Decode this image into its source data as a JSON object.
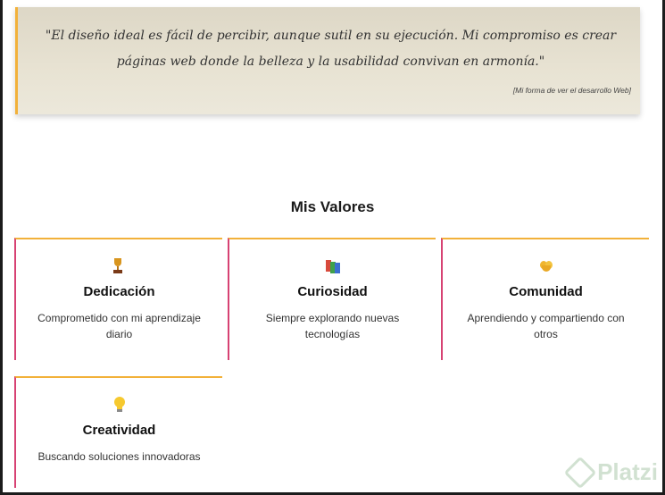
{
  "quote": {
    "text": "\"El diseño ideal es fácil de percibir, aunque sutil en su ejecución. Mi compromiso es crear páginas web donde la belleza y la usabilidad convivan en armonía.\"",
    "caption": "[Mi forma de ver el desarrollo Web]"
  },
  "values_section": {
    "title": "Mis Valores",
    "cards": [
      {
        "icon": "trophy-icon",
        "title": "Dedicación",
        "description": "Comprometido con mi aprendizaje diario"
      },
      {
        "icon": "books-icon",
        "title": "Curiosidad",
        "description": "Siempre explorando nuevas tecnologías"
      },
      {
        "icon": "heart-hands-icon",
        "title": "Comunidad",
        "description": "Aprendiendo y compartiendo con otros"
      },
      {
        "icon": "lightbulb-icon",
        "title": "Creatividad",
        "description": "Buscando soluciones innovadoras"
      }
    ]
  },
  "watermark": {
    "text": "Platzi"
  },
  "colors": {
    "accent_top": "#f2b13a",
    "accent_left": "#d74273",
    "quote_bg": "#e6e1d1"
  }
}
